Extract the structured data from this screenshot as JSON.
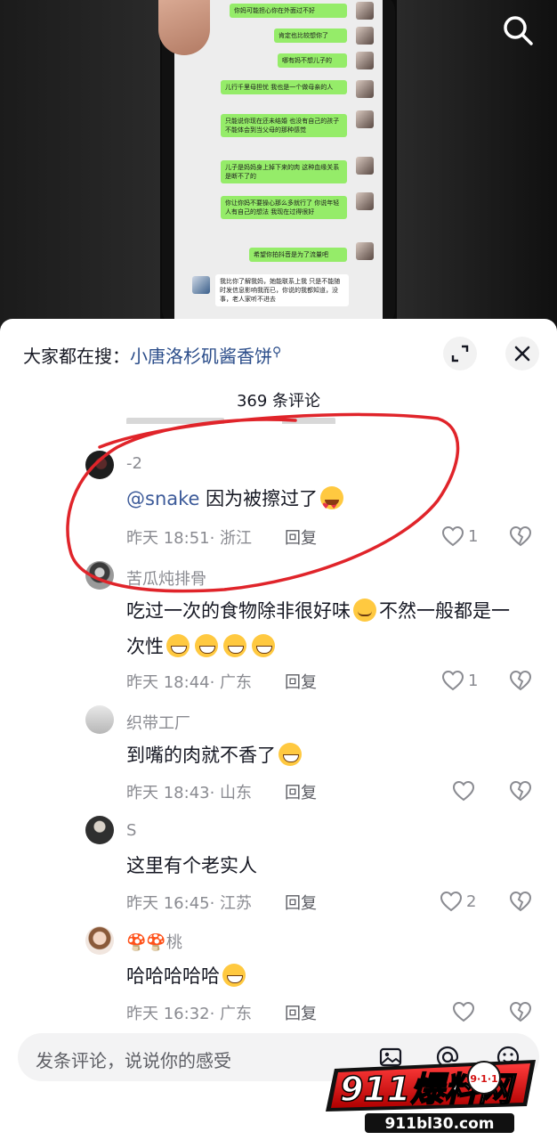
{
  "video": {
    "chat_messages": [
      {
        "text": "你妈可能担心你在外面过不好",
        "side": "right"
      },
      {
        "text": "肯定也比较想你了",
        "side": "right"
      },
      {
        "text": "哪有妈不想儿子的",
        "side": "right"
      },
      {
        "text": "儿行千里母担忧 我也是一个做母亲的人",
        "side": "right"
      },
      {
        "text": "只能说你现在还未结婚 也没有自己的孩子 不能体会到当父母的那种感觉",
        "side": "right"
      },
      {
        "text": "儿子是妈妈身上掉下来的肉 这种血缘关系是断不了的",
        "side": "right"
      },
      {
        "text": "你让你妈不要操心那么多就行了 你说年轻人有自己的想法 我现在过得很好",
        "side": "right"
      },
      {
        "text": "希望你拍抖音是为了流量吧",
        "side": "right"
      },
      {
        "text": "我比你了解我妈，她能联系上我 只是不能随时发信息影响我而已，你说的我都知道，没事，老人家听不进去",
        "side": "left"
      }
    ]
  },
  "sheet": {
    "search_prefix": "大家都在搜：",
    "search_keyword": "小唐洛杉矶酱香饼",
    "search_icon": "search-icon",
    "comment_count_title": "369 条评论"
  },
  "comments": [
    {
      "user": "-2",
      "mention": "@snake",
      "text": "因为被擦过了",
      "time": "昨天 18:51",
      "location": "· 浙江",
      "reply": "回复",
      "likes": "1"
    },
    {
      "user": "苦瓜炖排骨",
      "text_a": "吃过一次的食物除非很好味",
      "text_b": "不然一般都是一次性",
      "time": "昨天 18:44",
      "location": "· 广东",
      "reply": "回复",
      "likes": "1"
    },
    {
      "user": "织带工厂",
      "text": "到嘴的肉就不香了",
      "time": "昨天 18:43",
      "location": "· 山东",
      "reply": "回复",
      "likes": ""
    },
    {
      "user": "S",
      "text": "这里有个老实人",
      "time": "昨天 16:45",
      "location": "· 江苏",
      "reply": "回复",
      "likes": "2"
    },
    {
      "user": "桃",
      "text": "哈哈哈哈哈",
      "time": "昨天 16:32",
      "location": "· 广东",
      "reply": "回复",
      "likes": ""
    }
  ],
  "input": {
    "placeholder": "发条评论，说说你的感受"
  },
  "watermark": {
    "brand": "911爆料网",
    "url": "911bl30.com",
    "badge": "9·1·1"
  },
  "colors": {
    "link_blue": "#2b4d8a",
    "mention_blue": "#3c5a99",
    "annotation_red": "#e0242a",
    "chat_green": "#95ec69"
  }
}
